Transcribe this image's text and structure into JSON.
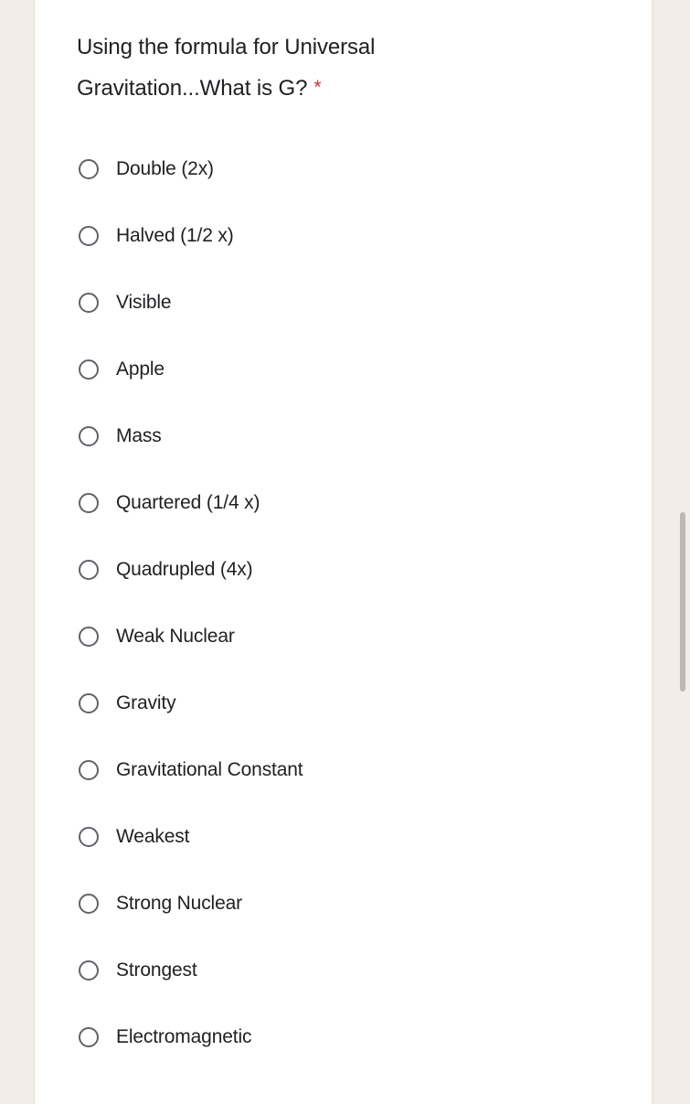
{
  "background_color": "#f3ece7",
  "card_color": "#ffffff",
  "question": {
    "title": "Using the formula for Universal Gravitation...What is G?",
    "required_marker": "*",
    "required_marker_color": "#d93025"
  },
  "options": [
    {
      "label": "Double (2x)"
    },
    {
      "label": "Halved (1/2 x)"
    },
    {
      "label": "Visible"
    },
    {
      "label": "Apple"
    },
    {
      "label": "Mass"
    },
    {
      "label": "Quartered (1/4 x)"
    },
    {
      "label": "Quadrupled (4x)"
    },
    {
      "label": "Weak Nuclear"
    },
    {
      "label": "Gravity"
    },
    {
      "label": "Gravitational Constant"
    },
    {
      "label": "Weakest"
    },
    {
      "label": "Strong Nuclear"
    },
    {
      "label": "Strongest"
    },
    {
      "label": "Electromagnetic"
    }
  ],
  "scrollbar": {
    "thumb_color": "#bdb8b3"
  }
}
